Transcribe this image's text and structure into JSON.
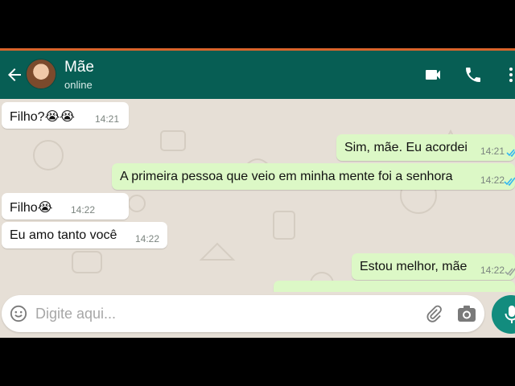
{
  "header": {
    "contact_name": "Mãe",
    "status": "online"
  },
  "messages": [
    {
      "direction": "incoming",
      "text": "Filho?😭😭",
      "time": "14:21"
    },
    {
      "direction": "outgoing",
      "text": "Sim, mãe. Eu acordei",
      "time": "14:21",
      "read": true
    },
    {
      "direction": "outgoing",
      "text": "A primeira pessoa que veio em minha mente foi a senhora",
      "time": "14:22",
      "read": true
    },
    {
      "direction": "incoming",
      "text": "Filho😭",
      "time": "14:22"
    },
    {
      "direction": "incoming",
      "text": "Eu amo tanto você",
      "time": "14:22"
    },
    {
      "direction": "outgoing",
      "text": "Estou melhor, mãe",
      "time": "14:22",
      "read": false
    }
  ],
  "composer": {
    "placeholder": "Digite aqui..."
  },
  "colors": {
    "header_bg": "#075e54",
    "outgoing_bubble": "#dcf8c6",
    "incoming_bubble": "#ffffff",
    "read_tick": "#34b7f1",
    "mic_button": "#128c7e",
    "accent_line": "#d9642b"
  },
  "icons": {
    "back": "arrow-left-icon",
    "video": "video-camera-icon",
    "call": "phone-icon",
    "more": "more-vertical-icon",
    "emoji": "emoji-icon",
    "attach": "paperclip-icon",
    "camera": "camera-icon",
    "mic": "microphone-icon",
    "tick": "double-check-icon"
  }
}
